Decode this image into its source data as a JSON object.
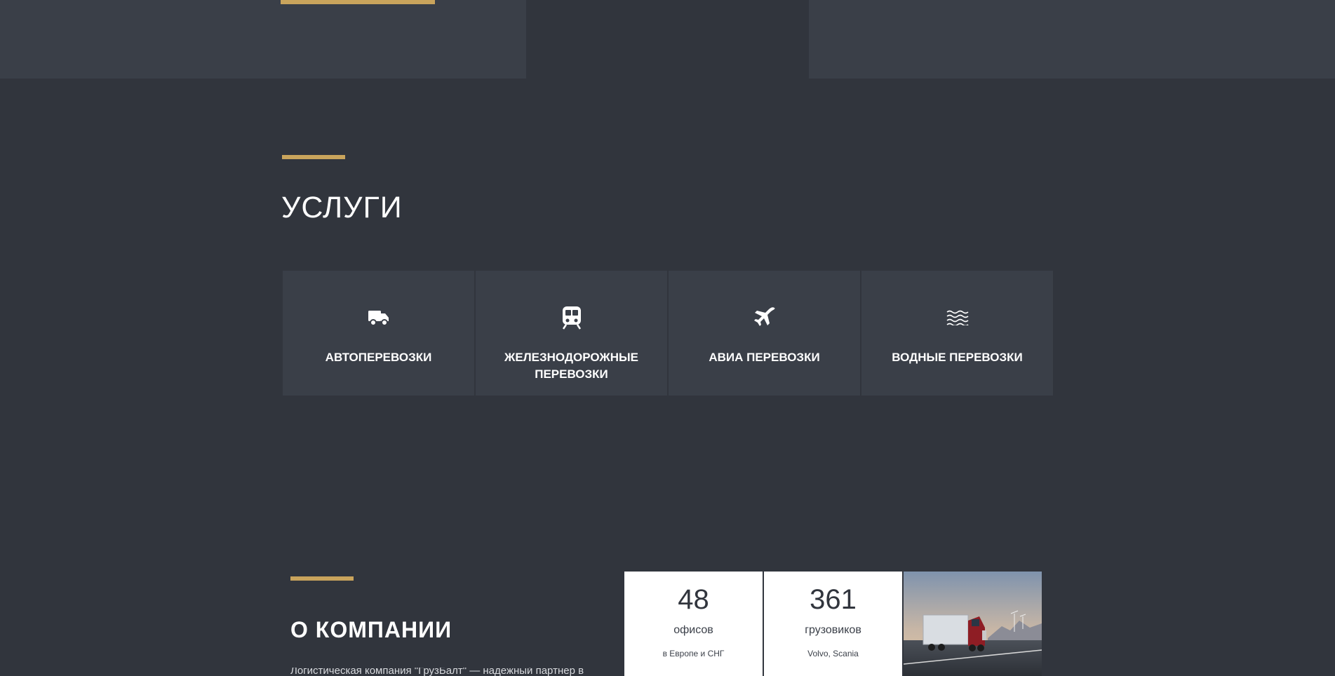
{
  "services": {
    "title": "УСЛУГИ",
    "items": [
      {
        "label": "АВТОПЕРЕВОЗКИ",
        "icon": "truck-icon"
      },
      {
        "label": "ЖЕЛЕЗНОДОРОЖНЫЕ ПЕРЕВОЗКИ",
        "icon": "train-icon"
      },
      {
        "label": "АВИА ПЕРЕВОЗКИ",
        "icon": "plane-icon"
      },
      {
        "label": "ВОДНЫЕ ПЕРЕВОЗКИ",
        "icon": "water-waves-icon"
      }
    ]
  },
  "about": {
    "title": "О КОМПАНИИ",
    "text": "Логистическая компания \"ГрузБалт\" — надежный партнер в сфере",
    "stats": [
      {
        "number": "48",
        "caption": "офисов",
        "sub": "в Европе и СНГ"
      },
      {
        "number": "361",
        "caption": "грузовиков",
        "sub": "Volvo, Scania"
      }
    ]
  },
  "colors": {
    "background": "#31353d",
    "panel": "#3a3f48",
    "accent": "#c9a45c",
    "text": "#ffffff"
  }
}
